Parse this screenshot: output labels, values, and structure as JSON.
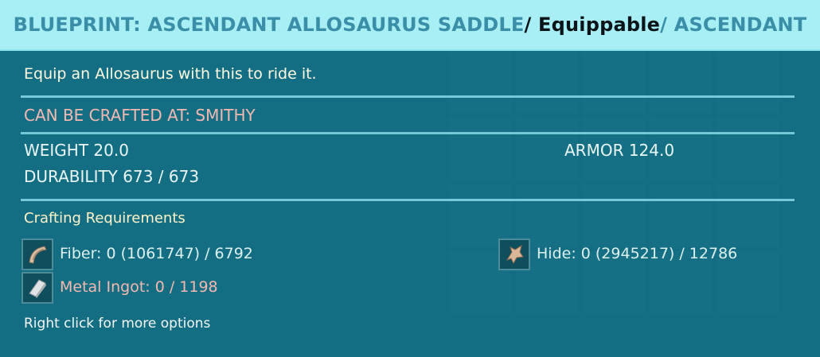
{
  "title": {
    "main": "BLUEPRINT: ASCENDANT ALLOSAURUS SADDLE",
    "separator": " / ",
    "type": "Equippable",
    "quality": "ASCENDANT"
  },
  "description": "Equip an Allosaurus with this to ride it.",
  "crafted_at": "CAN BE CRAFTED AT: SMITHY",
  "stats": {
    "weight": "WEIGHT 20.0",
    "armor": "ARMOR 124.0",
    "durability": "DURABILITY 673 / 673"
  },
  "requirements": {
    "title": "Crafting Requirements",
    "items": [
      {
        "label": "Fiber: 0 (1061747) / 6792",
        "icon": "fiber-icon",
        "color": "#ddf0ee"
      },
      {
        "label": "Hide: 0 (2945217) / 12786",
        "icon": "hide-icon",
        "color": "#ddf0ee"
      },
      {
        "label": "Metal Ingot: 0 / 1198",
        "icon": "metal-ingot-icon",
        "color": "#f3b9b0"
      }
    ]
  },
  "hint": "Right click for more options",
  "colors": {
    "title_bar": "#a7eef5",
    "title_accent": "#3a8ea8",
    "panel": "#1d6f82",
    "missing_resource": "#f3b9b0"
  }
}
